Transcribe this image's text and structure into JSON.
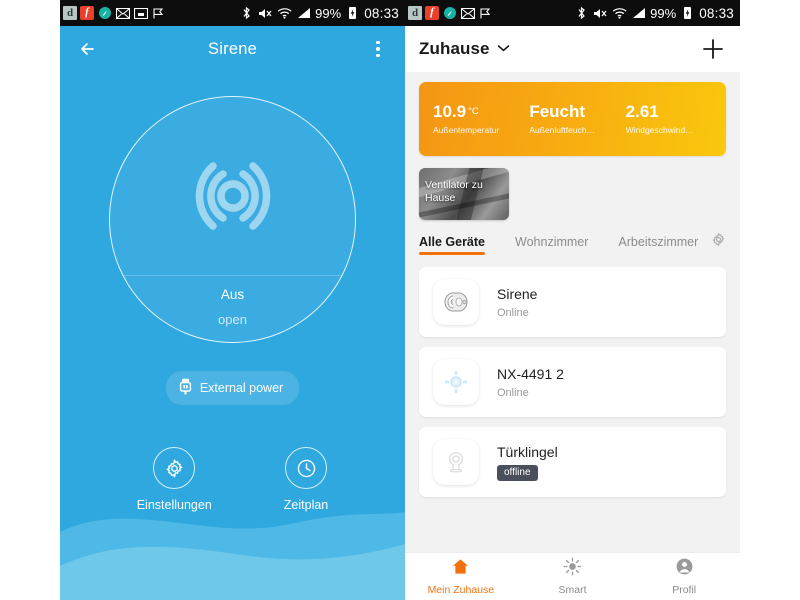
{
  "status_bar": {
    "icons_left": [
      "d-app-icon",
      "flash-icon",
      "browser-icon",
      "mail-icon",
      "screenshot-icon",
      "flag-icon"
    ],
    "icons_left_right_panel": [
      "d-app-icon",
      "flash-icon",
      "browser-icon",
      "mail-icon",
      "flag-icon"
    ],
    "bluetooth": "bluetooth-icon",
    "mute": "mute-icon",
    "wifi": "wifi-icon",
    "signal": "signal-icon",
    "battery_percent": "99%",
    "battery": "battery-charging-icon",
    "time": "08:33"
  },
  "left_screen": {
    "appbar": {
      "back": "back-arrow-icon",
      "title": "Sirene",
      "menu": "overflow-menu-icon"
    },
    "dial": {
      "icon": "siren-waves-icon",
      "state": "Aus",
      "substate": "open"
    },
    "external_power": {
      "icon": "usb-plug-icon",
      "label": "External power"
    },
    "actions": [
      {
        "icon": "gear-icon",
        "label": "Einstellungen"
      },
      {
        "icon": "clock-icon",
        "label": "Zeitplan"
      }
    ],
    "colors": {
      "background": "#2fa8e0",
      "wave_light": "#6ec8ea",
      "wave_mid": "#57bce6"
    }
  },
  "right_screen": {
    "header": {
      "title": "Zuhause",
      "chevron": "chevron-down-icon",
      "add": "plus-icon"
    },
    "weather": [
      {
        "value": "10.9",
        "unit": "°C",
        "label": "Außentemperatur"
      },
      {
        "value": "Feucht",
        "unit": "",
        "label": "Außenluftfeuch…"
      },
      {
        "value": "2.61",
        "unit": "",
        "label": "Windgeschwind…"
      }
    ],
    "scene": {
      "label": "Ventilator zu Hause"
    },
    "tabs": [
      {
        "label": "Alle Geräte",
        "active": true
      },
      {
        "label": "Wohnzimmer",
        "active": false
      },
      {
        "label": "Arbeitszimmer",
        "active": false
      }
    ],
    "tabs_settings_icon": "gear-icon",
    "devices": [
      {
        "name": "Sirene",
        "status": "Online",
        "offline": false,
        "icon": "siren-device-icon"
      },
      {
        "name": "NX-4491 2",
        "status": "Online",
        "offline": false,
        "icon": "sensor-device-icon"
      },
      {
        "name": "Türklingel",
        "status": "offline",
        "offline": true,
        "icon": "doorbell-camera-icon"
      }
    ],
    "bottom_nav": [
      {
        "label": "Mein Zuhause",
        "icon": "home-icon",
        "active": true
      },
      {
        "label": "Smart",
        "icon": "sun-icon",
        "active": false
      },
      {
        "label": "Profil",
        "icon": "person-icon",
        "active": false
      }
    ],
    "colors": {
      "accent": "#f0720f",
      "weather_start": "#f49614",
      "weather_end": "#fac80d",
      "offline_badge": "#4a4f5c",
      "background": "#f2f2f2"
    }
  }
}
